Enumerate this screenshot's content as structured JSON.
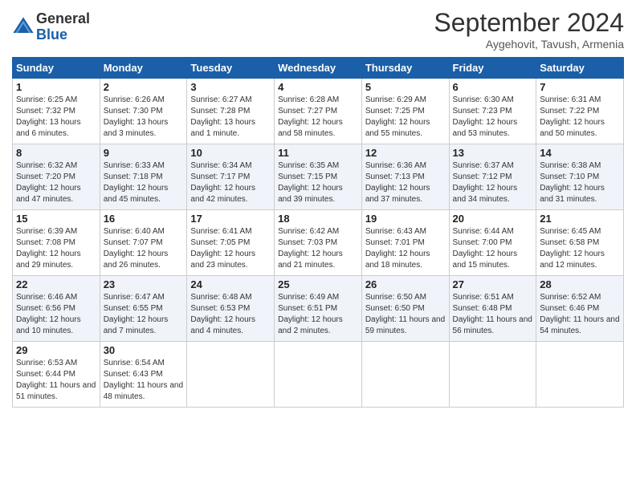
{
  "header": {
    "logo_general": "General",
    "logo_blue": "Blue",
    "month_title": "September 2024",
    "subtitle": "Aygehovit, Tavush, Armenia"
  },
  "days_of_week": [
    "Sunday",
    "Monday",
    "Tuesday",
    "Wednesday",
    "Thursday",
    "Friday",
    "Saturday"
  ],
  "weeks": [
    [
      {
        "day": "1",
        "sunrise": "6:25 AM",
        "sunset": "7:32 PM",
        "daylight": "13 hours and 6 minutes."
      },
      {
        "day": "2",
        "sunrise": "6:26 AM",
        "sunset": "7:30 PM",
        "daylight": "13 hours and 3 minutes."
      },
      {
        "day": "3",
        "sunrise": "6:27 AM",
        "sunset": "7:28 PM",
        "daylight": "13 hours and 1 minute."
      },
      {
        "day": "4",
        "sunrise": "6:28 AM",
        "sunset": "7:27 PM",
        "daylight": "12 hours and 58 minutes."
      },
      {
        "day": "5",
        "sunrise": "6:29 AM",
        "sunset": "7:25 PM",
        "daylight": "12 hours and 55 minutes."
      },
      {
        "day": "6",
        "sunrise": "6:30 AM",
        "sunset": "7:23 PM",
        "daylight": "12 hours and 53 minutes."
      },
      {
        "day": "7",
        "sunrise": "6:31 AM",
        "sunset": "7:22 PM",
        "daylight": "12 hours and 50 minutes."
      }
    ],
    [
      {
        "day": "8",
        "sunrise": "6:32 AM",
        "sunset": "7:20 PM",
        "daylight": "12 hours and 47 minutes."
      },
      {
        "day": "9",
        "sunrise": "6:33 AM",
        "sunset": "7:18 PM",
        "daylight": "12 hours and 45 minutes."
      },
      {
        "day": "10",
        "sunrise": "6:34 AM",
        "sunset": "7:17 PM",
        "daylight": "12 hours and 42 minutes."
      },
      {
        "day": "11",
        "sunrise": "6:35 AM",
        "sunset": "7:15 PM",
        "daylight": "12 hours and 39 minutes."
      },
      {
        "day": "12",
        "sunrise": "6:36 AM",
        "sunset": "7:13 PM",
        "daylight": "12 hours and 37 minutes."
      },
      {
        "day": "13",
        "sunrise": "6:37 AM",
        "sunset": "7:12 PM",
        "daylight": "12 hours and 34 minutes."
      },
      {
        "day": "14",
        "sunrise": "6:38 AM",
        "sunset": "7:10 PM",
        "daylight": "12 hours and 31 minutes."
      }
    ],
    [
      {
        "day": "15",
        "sunrise": "6:39 AM",
        "sunset": "7:08 PM",
        "daylight": "12 hours and 29 minutes."
      },
      {
        "day": "16",
        "sunrise": "6:40 AM",
        "sunset": "7:07 PM",
        "daylight": "12 hours and 26 minutes."
      },
      {
        "day": "17",
        "sunrise": "6:41 AM",
        "sunset": "7:05 PM",
        "daylight": "12 hours and 23 minutes."
      },
      {
        "day": "18",
        "sunrise": "6:42 AM",
        "sunset": "7:03 PM",
        "daylight": "12 hours and 21 minutes."
      },
      {
        "day": "19",
        "sunrise": "6:43 AM",
        "sunset": "7:01 PM",
        "daylight": "12 hours and 18 minutes."
      },
      {
        "day": "20",
        "sunrise": "6:44 AM",
        "sunset": "7:00 PM",
        "daylight": "12 hours and 15 minutes."
      },
      {
        "day": "21",
        "sunrise": "6:45 AM",
        "sunset": "6:58 PM",
        "daylight": "12 hours and 12 minutes."
      }
    ],
    [
      {
        "day": "22",
        "sunrise": "6:46 AM",
        "sunset": "6:56 PM",
        "daylight": "12 hours and 10 minutes."
      },
      {
        "day": "23",
        "sunrise": "6:47 AM",
        "sunset": "6:55 PM",
        "daylight": "12 hours and 7 minutes."
      },
      {
        "day": "24",
        "sunrise": "6:48 AM",
        "sunset": "6:53 PM",
        "daylight": "12 hours and 4 minutes."
      },
      {
        "day": "25",
        "sunrise": "6:49 AM",
        "sunset": "6:51 PM",
        "daylight": "12 hours and 2 minutes."
      },
      {
        "day": "26",
        "sunrise": "6:50 AM",
        "sunset": "6:50 PM",
        "daylight": "11 hours and 59 minutes."
      },
      {
        "day": "27",
        "sunrise": "6:51 AM",
        "sunset": "6:48 PM",
        "daylight": "11 hours and 56 minutes."
      },
      {
        "day": "28",
        "sunrise": "6:52 AM",
        "sunset": "6:46 PM",
        "daylight": "11 hours and 54 minutes."
      }
    ],
    [
      {
        "day": "29",
        "sunrise": "6:53 AM",
        "sunset": "6:44 PM",
        "daylight": "11 hours and 51 minutes."
      },
      {
        "day": "30",
        "sunrise": "6:54 AM",
        "sunset": "6:43 PM",
        "daylight": "11 hours and 48 minutes."
      },
      null,
      null,
      null,
      null,
      null
    ]
  ]
}
